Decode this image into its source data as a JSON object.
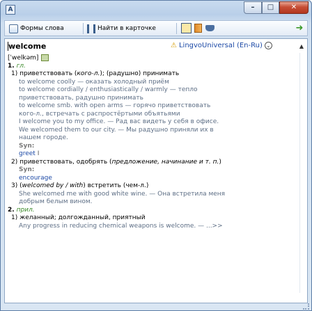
{
  "window": {
    "close_label": "✕",
    "max_label": "□",
    "min_label": "–"
  },
  "toolbar": {
    "forms_label": "Формы слова",
    "find_label": "Найти в карточке",
    "go_label": "➜"
  },
  "entry": {
    "headword": "welcome",
    "dictionary": "LingvoUniversal (En-Ru)",
    "transcription": "[ˈwelkəm]"
  },
  "lines": [
    {
      "num": "1.",
      "pos": "гл."
    },
    {
      "sense": "1) приветствовать (",
      "sense_it": "кого-л.",
      "sense_tail": "); (радушно) принимать"
    },
    {
      "text": "to welcome coolly — оказать холодный приём"
    },
    {
      "text": "to welcome cordially / enthusiastically / warmly — тепло"
    },
    {
      "text": "приветствовать, радушно принимать"
    },
    {
      "text": "to welcome smb. with open arms — горячо приветствовать"
    },
    {
      "text": "кого-л., встречать с распростёртыми объятьями"
    },
    {
      "text": "I welcome you to my office. — Рад вас видеть у себя в офисе."
    },
    {
      "text": "We welcomed them to our city. — Мы радушно приняли их в"
    },
    {
      "text": "нашем городе."
    },
    {
      "syn_head": "Syn:"
    },
    {
      "syn": "greet",
      "syn_sep": " I"
    },
    {
      "sense": "2) приветствовать, одобрять (",
      "sense_it": "предложение, начинание и т. п.",
      "sense_tail": ")"
    },
    {
      "syn_head": "Syn:"
    },
    {
      "syn": "encourage"
    },
    {
      "sense": "3) (",
      "sense_it": "welcomed by / with",
      "sense_tail": ") встретить (чем-л.)"
    },
    {
      "text": "She welcomed me with good white wine. — Она встретила меня"
    },
    {
      "text": "добрым белым вином."
    },
    {
      "num": "2.",
      "pos": "прил."
    },
    {
      "sense": "1) желанный; долгожданный, приятный"
    },
    {
      "text": "Any progress in reducing chemical weapons is welcome. — ...>>"
    }
  ]
}
